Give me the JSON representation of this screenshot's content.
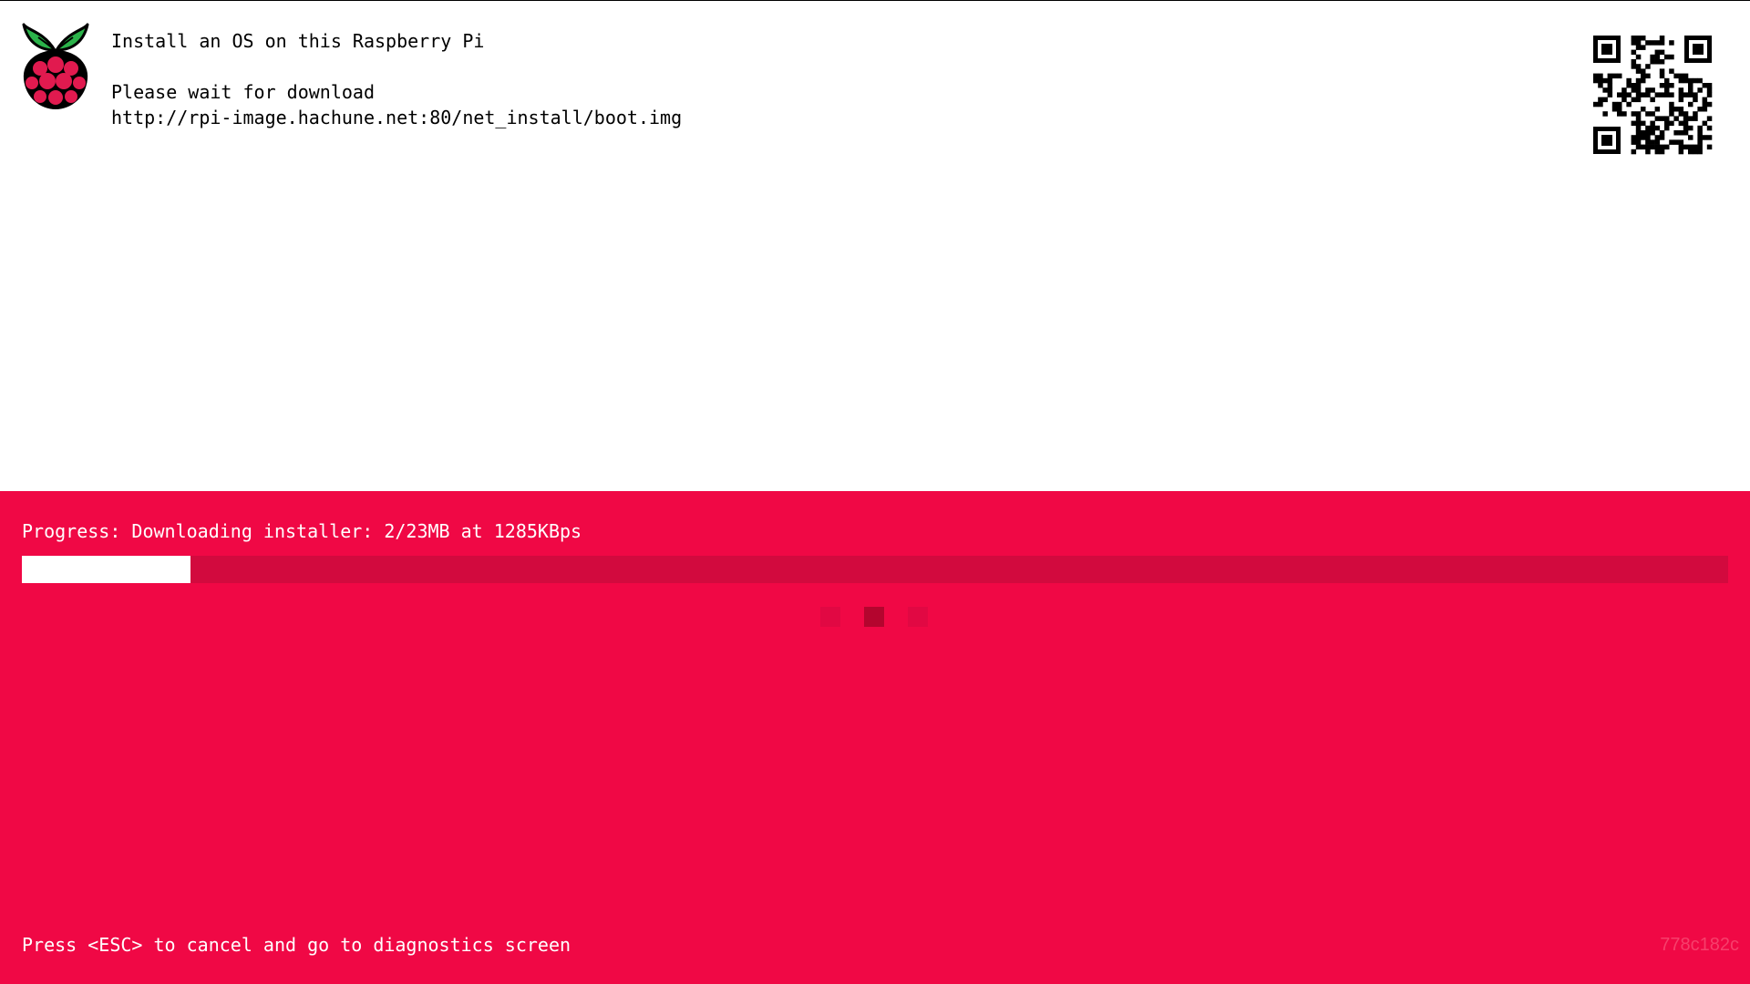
{
  "header": {
    "title": "Install an OS on this Raspberry Pi",
    "status": "Please wait for download",
    "url": "http://rpi-image.hachune.net:80/net_install/boot.img"
  },
  "progress": {
    "label": "Progress: Downloading installer: 2/23MB at 1285KBps",
    "downloaded_mb": 2,
    "total_mb": 23,
    "fraction": 0.099
  },
  "spinner": {
    "active_index": 1,
    "count": 3
  },
  "footer": {
    "hint": "Press <ESC> to cancel and go to diagnostics screen",
    "build_id": "778c182c"
  },
  "colors": {
    "accent": "#F00845",
    "track": "#D20A3E",
    "spinner_dot": "#E10843",
    "spinner_active": "#B4052E",
    "logo_red": "#E11A4F",
    "logo_green": "#2BB34A"
  },
  "icons": {
    "logo": "raspberry-pi-logo-icon",
    "qr": "qr-code-icon"
  }
}
